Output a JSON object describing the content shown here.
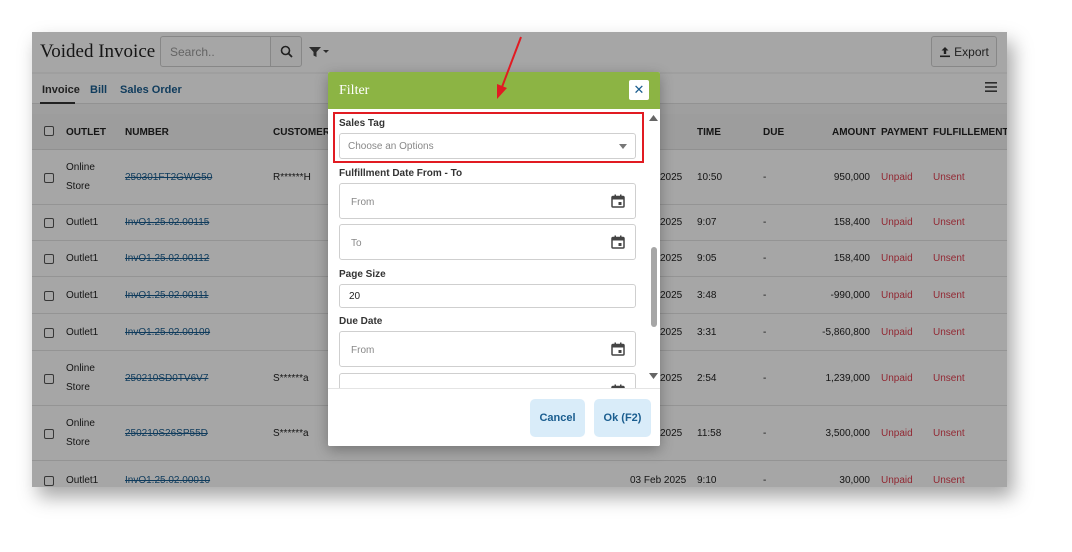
{
  "page": {
    "title": "Voided Invoice",
    "search_placeholder": "Search..",
    "export_label": "Export",
    "tabs": [
      {
        "label": "Invoice",
        "active": true
      },
      {
        "label": "Bill",
        "active": false
      },
      {
        "label": "Sales Order",
        "active": false
      }
    ]
  },
  "table": {
    "columns": [
      "OUTLET",
      "NUMBER",
      "CUSTOMER",
      "TIME",
      "DUE",
      "AMOUNT",
      "PAYMENT",
      "FULFILLEMENT"
    ],
    "rows": [
      {
        "outlet": [
          "Online",
          "Store"
        ],
        "number": "250301FT2GWG50",
        "customer": "R******H",
        "date": "2025",
        "time": "10:50",
        "due": "-",
        "amount": "950,000",
        "payment": "Unpaid",
        "fulfillment": "Unsent"
      },
      {
        "outlet": [
          "Outlet1"
        ],
        "number": "InvO1.25.02.00115",
        "customer": "",
        "date": "2025",
        "time": "9:07",
        "due": "-",
        "amount": "158,400",
        "payment": "Unpaid",
        "fulfillment": "Unsent"
      },
      {
        "outlet": [
          "Outlet1"
        ],
        "number": "InvO1.25.02.00112",
        "customer": "",
        "date": "2025",
        "time": "9:05",
        "due": "-",
        "amount": "158,400",
        "payment": "Unpaid",
        "fulfillment": "Unsent"
      },
      {
        "outlet": [
          "Outlet1"
        ],
        "number": "InvO1.25.02.00111",
        "customer": "",
        "date": "2025",
        "time": "3:48",
        "due": "-",
        "amount": "-990,000",
        "payment": "Unpaid",
        "fulfillment": "Unsent"
      },
      {
        "outlet": [
          "Outlet1"
        ],
        "number": "InvO1.25.02.00109",
        "customer": "",
        "date": "2025",
        "time": "3:31",
        "due": "-",
        "amount": "-5,860,800",
        "payment": "Unpaid",
        "fulfillment": "Unsent"
      },
      {
        "outlet": [
          "Online",
          "Store"
        ],
        "number": "250210SD0TV6V7",
        "customer": "S******a",
        "date": "2025",
        "time": "2:54",
        "due": "-",
        "amount": "1,239,000",
        "payment": "Unpaid",
        "fulfillment": "Unsent"
      },
      {
        "outlet": [
          "Online",
          "Store"
        ],
        "number": "250210S26SP55D",
        "customer": "S******a",
        "date": "2025",
        "time": "11:58",
        "due": "-",
        "amount": "3,500,000",
        "payment": "Unpaid",
        "fulfillment": "Unsent"
      },
      {
        "outlet": [
          "Outlet1"
        ],
        "number": "InvO1.25.02.00010",
        "customer": "",
        "date": "03 Feb 2025",
        "time": "9:10",
        "due": "-",
        "amount": "30,000",
        "payment": "Unpaid",
        "fulfillment": "Unsent"
      }
    ]
  },
  "filter_dialog": {
    "title": "Filter",
    "close_glyph": "✕",
    "sales_tag": {
      "label": "Sales Tag",
      "placeholder": "Choose an Options"
    },
    "fulfillment_date": {
      "label": "Fulfillment Date From - To",
      "from_placeholder": "From",
      "to_placeholder": "To"
    },
    "page_size": {
      "label": "Page Size",
      "value": "20"
    },
    "due_date": {
      "label": "Due Date",
      "from_placeholder": "From"
    },
    "cancel_label": "Cancel",
    "ok_label": "Ok (F2)"
  },
  "colors": {
    "header_green": "#8cb444",
    "link_blue": "#1a5d8f",
    "status_red": "#e04050",
    "highlight_red": "#e11b22",
    "button_bg": "#d9ecf9"
  }
}
